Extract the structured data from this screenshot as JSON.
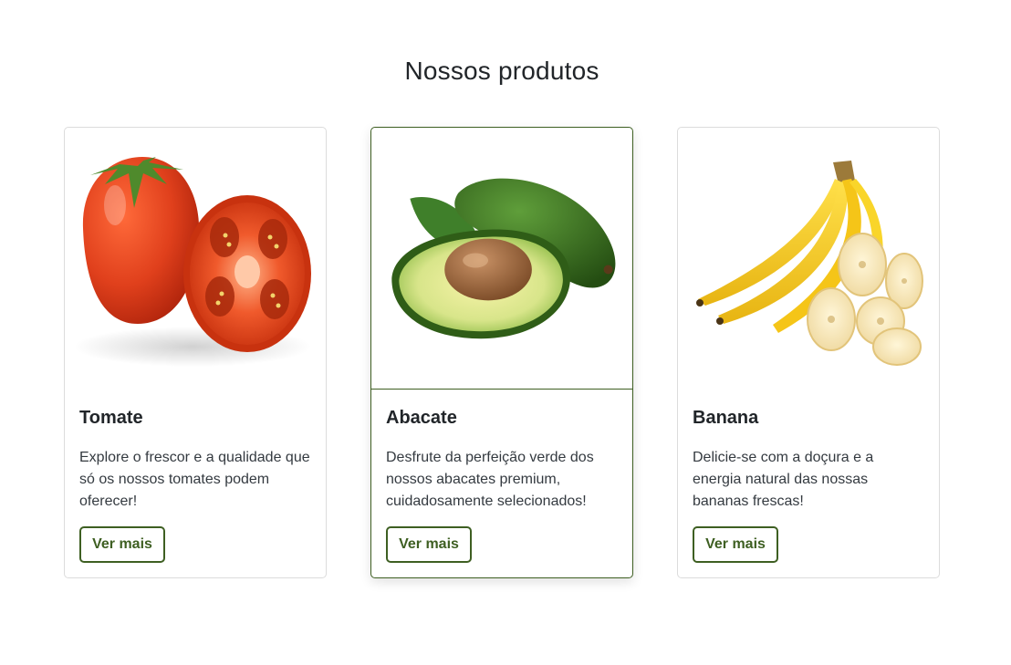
{
  "section": {
    "title": "Nossos produtos"
  },
  "products": [
    {
      "image": "tomato-image",
      "title": "Tomate",
      "text": "Explore o frescor e a qualidade que só os nossos tomates podem oferecer!",
      "button": "Ver mais"
    },
    {
      "image": "avocado-image",
      "title": "Abacate",
      "text": "Desfrute da perfeição verde dos nossos abacates premium, cuidadosamente selecionados!",
      "button": "Ver mais"
    },
    {
      "image": "banana-image",
      "title": "Banana",
      "text": "Delicie-se com a doçura e a energia natural das nossas bananas frescas!",
      "button": "Ver mais"
    }
  ],
  "colors": {
    "accent": "#3e5f22",
    "text": "#212529",
    "border": "#dcdcdc"
  }
}
